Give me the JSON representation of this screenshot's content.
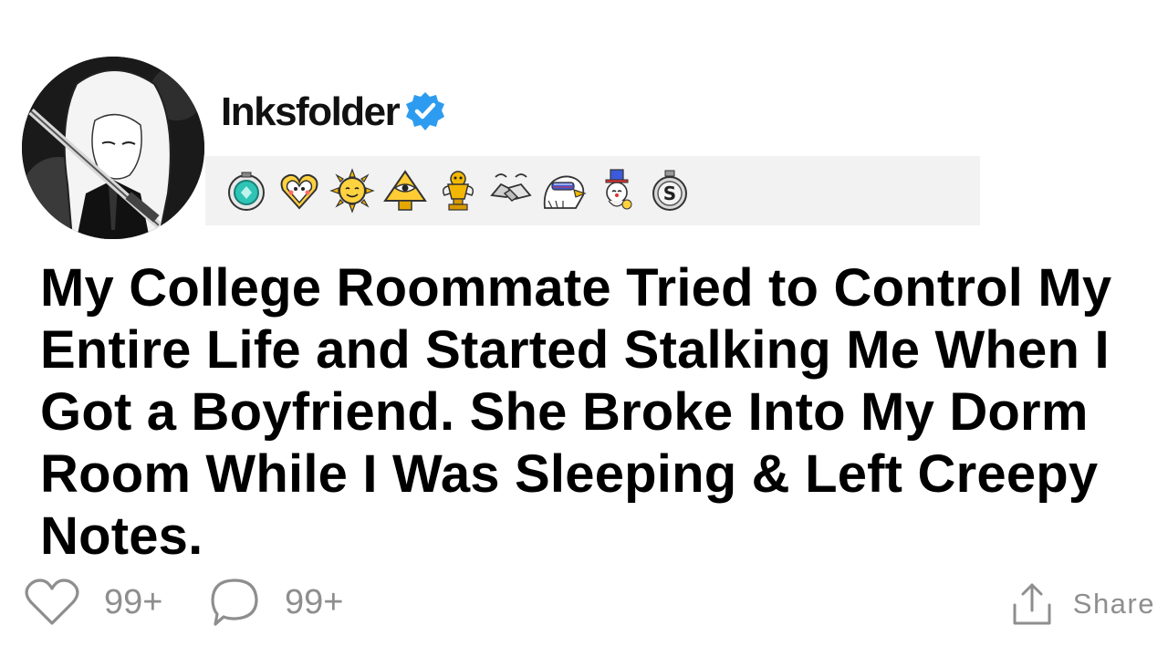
{
  "post": {
    "author": {
      "username": "Inksfolder",
      "verified": true,
      "avatar_icon": "anime-character-avatar"
    },
    "awards": [
      {
        "name": "diamond-award-icon"
      },
      {
        "name": "wholesome-heart-award-icon"
      },
      {
        "name": "sun-award-icon"
      },
      {
        "name": "illuminati-pyramid-award-icon"
      },
      {
        "name": "gold-trophy-award-icon"
      },
      {
        "name": "handshake-award-icon"
      },
      {
        "name": "eagle-award-icon"
      },
      {
        "name": "uncle-sam-award-icon"
      },
      {
        "name": "silver-s-award-icon"
      }
    ],
    "title": "My College Roommate Tried to Control My Entire Life and Started Stalking Me When I Got a Boyfriend. She Broke Into My Dorm Room While I Was Sleeping & Left Creepy Notes.",
    "likes_count": "99+",
    "comments_count": "99+",
    "share_label": "Share"
  },
  "colors": {
    "verified_badge": "#2d9cf0",
    "award_bar_bg": "#f2f2f2",
    "meta_text": "#8e8e8e",
    "title_text": "#000000"
  }
}
